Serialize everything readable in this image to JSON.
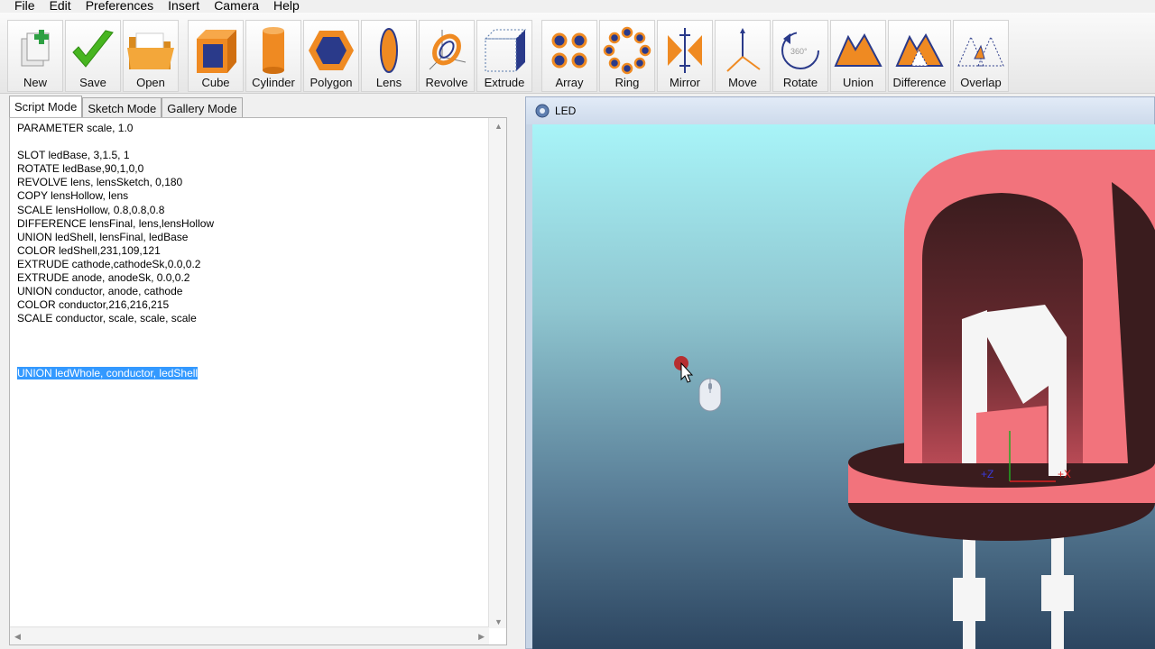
{
  "menu": [
    "File",
    "Edit",
    "Preferences",
    "Insert",
    "Camera",
    "Help"
  ],
  "toolbar": [
    {
      "label": "New",
      "icon": "new-file-icon"
    },
    {
      "label": "Save",
      "icon": "checkmark-icon"
    },
    {
      "label": "Open",
      "icon": "folder-icon"
    },
    {
      "label": "Cube",
      "icon": "cube-icon"
    },
    {
      "label": "Cylinder",
      "icon": "cylinder-icon"
    },
    {
      "label": "Polygon",
      "icon": "hexagon-icon"
    },
    {
      "label": "Lens",
      "icon": "lens-icon"
    },
    {
      "label": "Revolve",
      "icon": "revolve-icon"
    },
    {
      "label": "Extrude",
      "icon": "extrude-icon"
    },
    {
      "label": "Array",
      "icon": "array-icon"
    },
    {
      "label": "Ring",
      "icon": "ring-icon"
    },
    {
      "label": "Mirror",
      "icon": "mirror-icon"
    },
    {
      "label": "Move",
      "icon": "move-axes-icon"
    },
    {
      "label": "Rotate",
      "icon": "rotate-icon"
    },
    {
      "label": "Union",
      "icon": "union-icon"
    },
    {
      "label": "Difference",
      "icon": "difference-icon"
    },
    {
      "label": "Overlap",
      "icon": "overlap-icon"
    }
  ],
  "tabs": [
    "Script Mode",
    "Sketch Mode",
    "Gallery Mode"
  ],
  "script": [
    "PARAMETER scale, 1.0",
    "",
    "SLOT ledBase, 3,1.5, 1",
    "ROTATE ledBase,90,1,0,0",
    "REVOLVE lens, lensSketch, 0,180",
    "COPY lensHollow, lens",
    "SCALE lensHollow, 0.8,0.8,0.8",
    "DIFFERENCE lensFinal, lens,lensHollow",
    "UNION ledShell, lensFinal, ledBase",
    "COLOR ledShell,231,109,121",
    "EXTRUDE cathode,cathodeSk,0.0,0.2",
    "EXTRUDE anode, anodeSk, 0.0,0.2",
    "UNION conductor, anode, cathode",
    "COLOR conductor,216,216,215",
    "SCALE conductor, scale, scale, scale",
    "",
    "",
    "",
    "UNION ledWhole, conductor, ledShell"
  ],
  "selected_line_index": 18,
  "viewport": {
    "title": "LED",
    "axis_labels": {
      "z": "+Z",
      "x": "+X"
    },
    "colors": {
      "shell": "#f2737c",
      "shell_dark": "#3a1c1e",
      "conductor": "#f5f5f5",
      "sky_top": "#a8f4f8",
      "ground": "#34506a"
    }
  }
}
